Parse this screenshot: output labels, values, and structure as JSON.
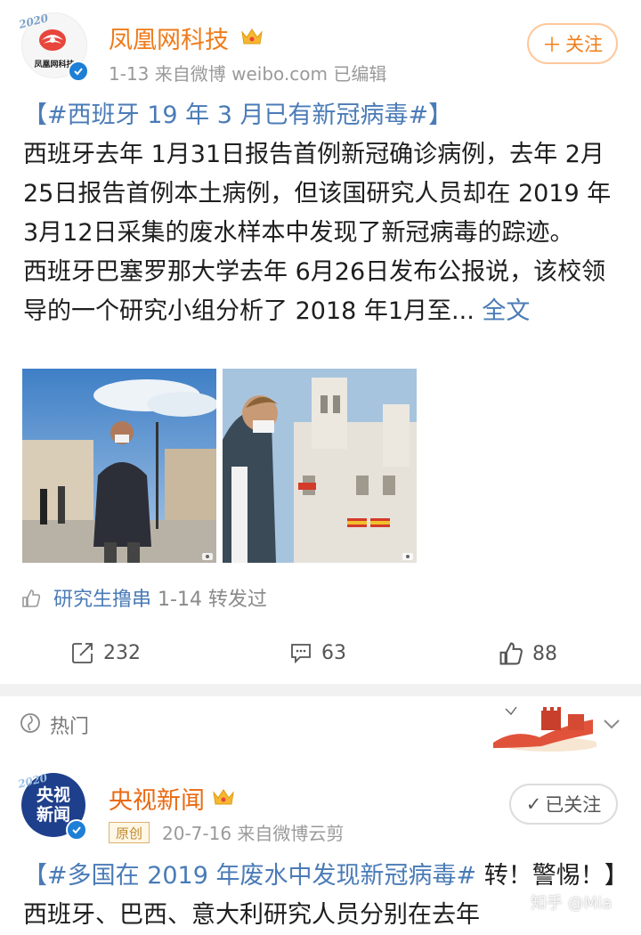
{
  "post1": {
    "author": "凤凰网科技",
    "avatar_text": "凤凰网科技",
    "avatar_badge": "2020",
    "meta": "1-13  来自微博 weibo.com  已编辑",
    "follow_label": "关注",
    "hashtag": "【#西班牙 19 年 3 月已有新冠病毒#】",
    "para1": "西班牙去年 1月31日报告首例新冠确诊病例，去年 2月25日报告首例本土病例，但该国研究人员却在 2019 年 3月12日采集的废水样本中发现了新冠病毒的踪迹。",
    "para2": " 西班牙巴塞罗那大学去年 6月26日发布公报说，该校领导的一个研究小组分析了 2018 年1月至... ",
    "more_link": "全文",
    "repost_user": "研究生撸串",
    "repost_suffix": " 1-14 转发过",
    "actions": {
      "reposts": "232",
      "comments": "63",
      "likes": "88"
    }
  },
  "hot": {
    "label": "热门"
  },
  "post2": {
    "author": "央视新闻",
    "avatar_text_line1": "央视",
    "avatar_text_line2": "新闻",
    "avatar_badge": "2020",
    "original_badge": "原创",
    "meta": "20-7-16  来自微博云剪",
    "followed_label": "已关注",
    "hashtag": "【#多国在 2019 年废水中发现新冠病毒#",
    "text_after_tag": " 转！警惕！】西班牙、巴西、意大利研究人员分别在去年"
  },
  "watermark": "知乎 @Mia",
  "colors": {
    "orange_name": "#ee7b1a",
    "link_blue": "#4a7bb7",
    "meta_gray": "#9a9a9a"
  }
}
